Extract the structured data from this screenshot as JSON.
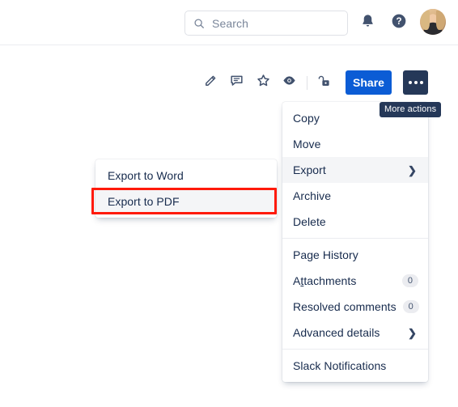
{
  "topnav": {
    "search": {
      "placeholder": "Search",
      "icon": "search-icon"
    },
    "notifications_icon": "bell-icon",
    "help_icon": "help-circle-icon",
    "avatar_label": "user-avatar"
  },
  "page_toolbar": {
    "icons": [
      {
        "name": "edit-pencil-icon"
      },
      {
        "name": "comment-icon"
      },
      {
        "name": "star-icon"
      },
      {
        "name": "watch-eye-icon"
      },
      {
        "name": "unlock-restrictions-icon"
      }
    ],
    "share_label": "Share",
    "more_actions_dots": "•••"
  },
  "tooltip": {
    "more_actions": "More actions"
  },
  "more_menu": {
    "groups": [
      {
        "items": [
          {
            "label": "Copy",
            "type": "plain",
            "selected": false
          },
          {
            "label": "Move",
            "type": "plain",
            "selected": false
          },
          {
            "label": "Export",
            "type": "submenu",
            "selected": true,
            "chevron": "❯"
          },
          {
            "label": "Archive",
            "type": "plain",
            "selected": false
          },
          {
            "label": "Delete",
            "type": "plain",
            "selected": false
          }
        ]
      },
      {
        "items": [
          {
            "label": "Page History",
            "type": "plain",
            "selected": false
          },
          {
            "label": "Attachments",
            "type": "badge",
            "badge": "0",
            "accesskey": "t",
            "selected": false
          },
          {
            "label": "Resolved comments",
            "type": "badge",
            "badge": "0",
            "selected": false
          },
          {
            "label": "Advanced details",
            "type": "submenu",
            "chevron": "❯",
            "selected": false
          }
        ]
      },
      {
        "items": [
          {
            "label": "Slack Notifications",
            "type": "plain",
            "selected": false
          }
        ]
      }
    ]
  },
  "export_submenu": {
    "items": [
      {
        "label": "Export to Word",
        "highlighted": false
      },
      {
        "label": "Export to PDF",
        "highlighted": true
      }
    ]
  },
  "annotation": {
    "highlight_color": "#FF1A0A",
    "target": "Export to PDF"
  },
  "colors": {
    "share_blue": "#0B5CD5",
    "dark_navy": "#253858",
    "text": "#172B4D",
    "hover_grey": "#F4F5F7",
    "border_grey": "#DFE1E6"
  }
}
